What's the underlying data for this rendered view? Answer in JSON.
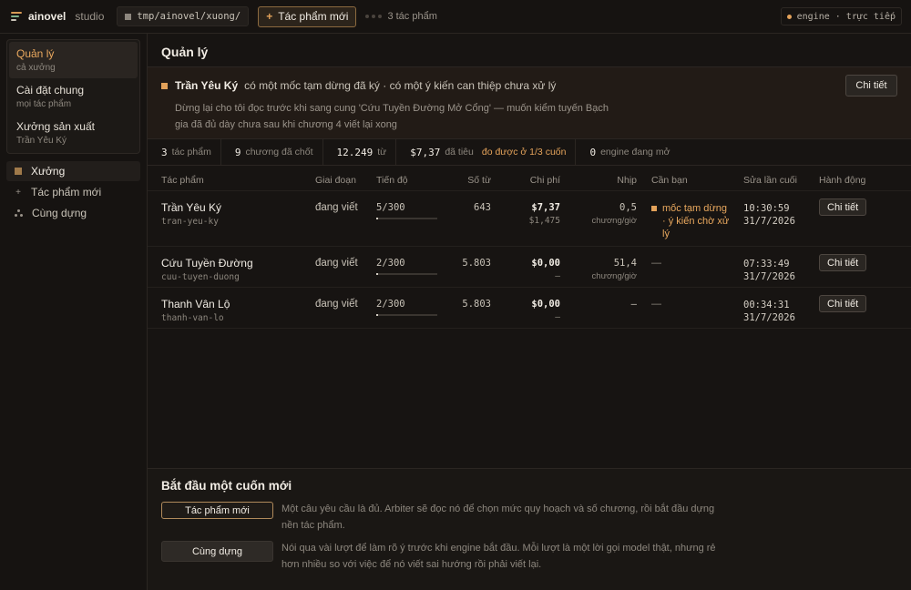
{
  "topbar": {
    "brand_name": "ainovel",
    "brand_sub": "studio",
    "path": "tmp/ainovel/xuong/",
    "new_work_label": "Tác phẩm mới",
    "works_count": "3 tác phẩm",
    "engine_status": "engine · trực tiếp"
  },
  "sidebar": {
    "groups": [
      {
        "title": "Quản lý",
        "subtitle": "cả xưởng"
      },
      {
        "title": "Cài đặt chung",
        "subtitle": "mọi tác phẩm"
      },
      {
        "title": "Xưởng sản xuất",
        "subtitle": "Trần Yêu Ký"
      }
    ],
    "nav": [
      {
        "label": "Xưởng"
      },
      {
        "label": "Tác phẩm mới"
      },
      {
        "label": "Cùng dựng"
      }
    ]
  },
  "main": {
    "title": "Quản lý",
    "alert": {
      "name": "Trần Yêu Ký",
      "summary": "có một mốc tạm dừng đã ký · có một ý kiến can thiệp chưa xử lý",
      "body": "Dừng lại cho tôi đọc trước khi sang cung 'Cứu Tuyền Đường Mở Cổng' — muốn kiểm tuyến Bạch gia đã đủ dày chưa sau khi chương 4 viết lại xong",
      "button": "Chi tiết"
    },
    "stats": [
      {
        "value": "3",
        "label": "tác phẩm"
      },
      {
        "value": "9",
        "label": "chương đã chốt"
      },
      {
        "value": "12.249",
        "label": "từ"
      },
      {
        "value": "$7,37",
        "label": "đã tiêu",
        "warn": "đo được ở 1/3 cuốn"
      },
      {
        "value": "0",
        "label": "engine đang mở"
      }
    ],
    "table": {
      "headers": {
        "work": "Tác phẩm",
        "stage": "Giai đoạn",
        "progress": "Tiến độ",
        "words": "Số từ",
        "cost": "Chi phí",
        "pace": "Nhịp",
        "needs": "Cần bạn",
        "updated": "Sửa lần cuối",
        "action": "Hành động"
      },
      "rows": [
        {
          "name": "Trần Yêu Ký",
          "slug": "tran-yeu-ky",
          "stage": "đang viết",
          "progress": "5/300",
          "progress_fraction": 0.0167,
          "words": "643",
          "cost": "$7,37",
          "cost_sub": "$1,475",
          "pace": "0,5",
          "pace_unit": "chương/giờ",
          "needs": "mốc tạm dừng · ý kiến chờ xử lý",
          "time": "10:30:59",
          "date": "31/7/2026",
          "action": "Chi tiết"
        },
        {
          "name": "Cứu Tuyền Đường",
          "slug": "cuu-tuyen-duong",
          "stage": "đang viết",
          "progress": "2/300",
          "progress_fraction": 0.0067,
          "words": "5.803",
          "cost": "$0,00",
          "cost_sub": "—",
          "pace": "51,4",
          "pace_unit": "chương/giờ",
          "needs": "—",
          "time": "07:33:49",
          "date": "31/7/2026",
          "action": "Chi tiết"
        },
        {
          "name": "Thanh Vân Lộ",
          "slug": "thanh-van-lo",
          "stage": "đang viết",
          "progress": "2/300",
          "progress_fraction": 0.0067,
          "words": "5.803",
          "cost": "$0,00",
          "cost_sub": "—",
          "pace": "—",
          "pace_unit": "",
          "needs": "—",
          "time": "00:34:31",
          "date": "31/7/2026",
          "action": "Chi tiết"
        }
      ]
    },
    "start": {
      "title": "Bắt đầu một cuốn mới",
      "options": [
        {
          "button": "Tác phẩm mới",
          "desc": "Một câu yêu cầu là đủ. Arbiter sẽ đọc nó để chọn mức quy hoạch và số chương, rồi bắt đầu dựng nền tác phẩm."
        },
        {
          "button": "Cùng dựng",
          "desc": "Nói qua vài lượt để làm rõ ý trước khi engine bắt đầu. Mỗi lượt là một lời gọi model thật, nhưng rẻ hơn nhiều so với việc để nó viết sai hướng rồi phải viết lại."
        }
      ]
    }
  }
}
